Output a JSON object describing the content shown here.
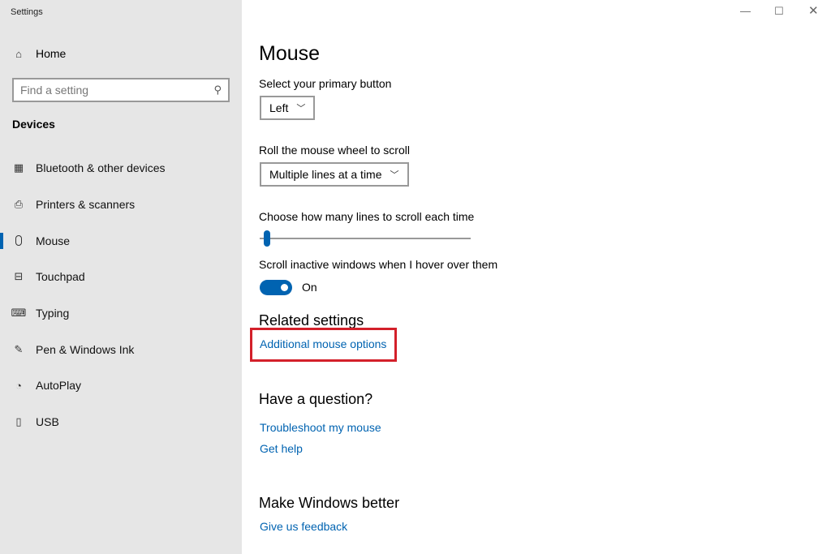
{
  "window": {
    "title": "Settings",
    "controls": [
      "minimize",
      "maximize",
      "close"
    ]
  },
  "sidebar": {
    "home_label": "Home",
    "search_placeholder": "Find a setting",
    "section": "Devices",
    "items": [
      {
        "label": "Bluetooth & other devices",
        "icon": "bluetooth-devices-icon"
      },
      {
        "label": "Printers & scanners",
        "icon": "printer-icon"
      },
      {
        "label": "Mouse",
        "icon": "mouse-icon",
        "selected": true
      },
      {
        "label": "Touchpad",
        "icon": "touchpad-icon"
      },
      {
        "label": "Typing",
        "icon": "keyboard-icon"
      },
      {
        "label": "Pen & Windows Ink",
        "icon": "pen-icon"
      },
      {
        "label": "AutoPlay",
        "icon": "autoplay-icon"
      },
      {
        "label": "USB",
        "icon": "usb-icon"
      }
    ]
  },
  "main": {
    "title": "Mouse",
    "primary_button_label": "Select your primary button",
    "primary_button_value": "Left",
    "wheel_label": "Roll the mouse wheel to scroll",
    "wheel_value": "Multiple lines at a time",
    "lines_label": "Choose how many lines to scroll each time",
    "lines_slider_fraction": 0.02,
    "inactive_label": "Scroll inactive windows when I hover over them",
    "inactive_toggle_on": true,
    "inactive_state": "On",
    "related_heading": "Related settings",
    "additional_link": "Additional mouse options",
    "question_heading": "Have a question?",
    "troubleshoot_link": "Troubleshoot my mouse",
    "help_link": "Get help",
    "better_heading": "Make Windows better",
    "feedback_link": "Give us feedback"
  },
  "colors": {
    "accent": "#0063b1",
    "highlight": "#d3202a",
    "sidebar": "#e6e6e6"
  }
}
